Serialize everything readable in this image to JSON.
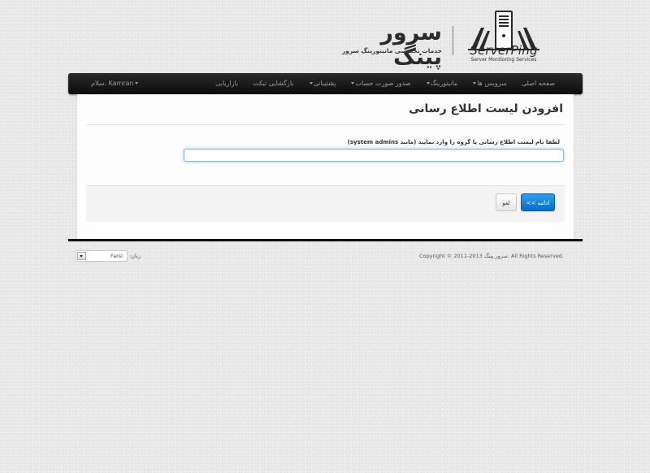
{
  "header": {
    "brand_fa": "سرور پینگ",
    "tagline_fa": "خدمات تخصصی مانیتورینگ سرور",
    "brand_en": "ServerPing",
    "brand_en_sub": "Server Monitoring Services"
  },
  "navbar": {
    "items": [
      {
        "label": "صفحه اصلی",
        "dropdown": false
      },
      {
        "label": "سرویس ها",
        "dropdown": true
      },
      {
        "label": "مانیتورینگ",
        "dropdown": true
      },
      {
        "label": "صدور صورت حساب",
        "dropdown": true
      },
      {
        "label": "پشتیبانی",
        "dropdown": true
      },
      {
        "label": "بازگشایی تیکت",
        "dropdown": false
      },
      {
        "label": "بازاریابی",
        "dropdown": false
      }
    ],
    "user_greeting": "سلام، Kamran"
  },
  "form": {
    "title": "افزودن لیست اطلاع رسانی",
    "field_label": "لطفا نام لیست اطلاع رسانی یا گروه را وارد نمایید (مانند system admins)",
    "field_value": "",
    "submit_label": "ادامه >>",
    "cancel_label": "لغو"
  },
  "footer": {
    "copyright": "Copyright © 2011-2013 سرور پینگ. All Rights Reserved.",
    "language_label": "زبان:",
    "language_value": "Farsi"
  },
  "colors": {
    "navbar_bg": "#111111",
    "primary_button": "#1583dc",
    "input_focus": "#8fb6e6"
  }
}
